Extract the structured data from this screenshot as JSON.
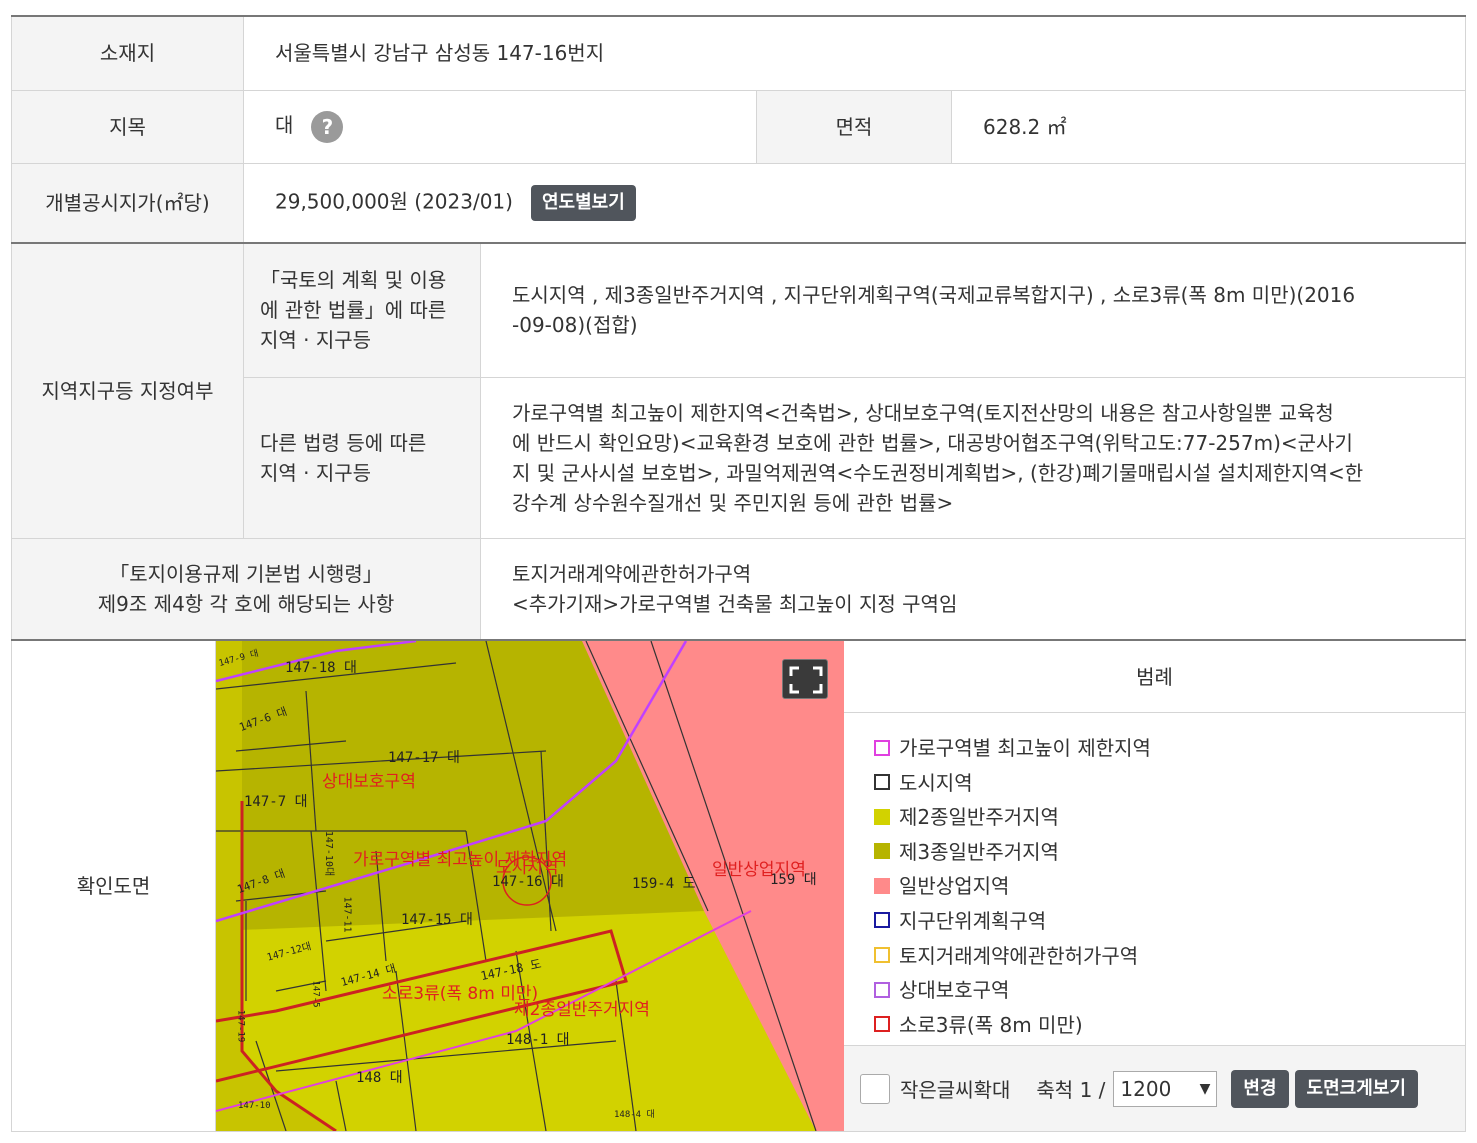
{
  "location": {
    "label": "소재지",
    "value": "서울특별시 강남구 삼성동 147-16번지"
  },
  "land_category": {
    "label": "지목",
    "value": "대",
    "help": "?"
  },
  "area": {
    "label": "면적",
    "value": "628.2 ㎡"
  },
  "price": {
    "label": "개별공시지가(㎡당)",
    "value": "29,500,000원 (2023/01)",
    "button": "연도별보기"
  },
  "zoning": {
    "label": "지역지구등 지정여부",
    "national": {
      "label_lines": [
        "「국토의 계획 및 이용",
        "에 관한 법률」에 따른",
        "지역 · 지구등"
      ],
      "value_lines": [
        "도시지역 , 제3종일반주거지역 , 지구단위계획구역(국제교류복합지구) , 소로3류(폭 8m 미만)(2016",
        "-09-08)(접합)"
      ]
    },
    "other": {
      "label_lines": [
        "다른 법령 등에 따른",
        "지역 · 지구등"
      ],
      "value_lines": [
        "가로구역별 최고높이 제한지역<건축법>, 상대보호구역(토지전산망의 내용은 참고사항일뿐 교육청",
        "에 반드시 확인요망)<교육환경 보호에 관한 법률>, 대공방어협조구역(위탁고도:77-257m)<군사기",
        "지 및 군사시설 보호법>, 과밀억제권역<수도권정비계획법>, (한강)폐기물매립시설 설치제한지역<한",
        "강수계 상수원수질개선 및 주민지원 등에 관한 법률>"
      ]
    }
  },
  "regulation": {
    "label_lines": [
      "「토지이용규제 기본법 시행령」",
      "제9조 제4항 각 호에 해당되는 사항"
    ],
    "value_lines": [
      "토지거래계약에관한허가구역",
      "<추가기재>가로구역별 건축물 최고높이 지정 구역임"
    ]
  },
  "map": {
    "label": "확인도면",
    "parcels": [
      "147-18 대",
      "147-6 대",
      "147-17 대",
      "147-7 대",
      "147-10대",
      "147-8 대",
      "147-16 대",
      "159-4 도",
      "159 대",
      "147-15 대",
      "147-11",
      "147-12대",
      "147-14 대",
      "147-18 도",
      "148-1 대",
      "148 대",
      "147-9 대",
      "147-10",
      "148-4 대",
      "147-5",
      "147-19"
    ],
    "zone_labels": [
      "상대보호구역",
      "가로구역별 최고높이 제한지역",
      "도시지역",
      "일반상업지역",
      "소로3류(폭 8m 미만)",
      "제2종일반주거지역"
    ]
  },
  "legend": {
    "title": "범례",
    "items": [
      {
        "label": "가로구역별 최고높이 제한지역",
        "fill": "#ffffff",
        "border": "#e040e0"
      },
      {
        "label": "도시지역",
        "fill": "#ffffff",
        "border": "#333333"
      },
      {
        "label": "제2종일반주거지역",
        "fill": "#d2d200",
        "border": "#d2d200"
      },
      {
        "label": "제3종일반주거지역",
        "fill": "#b6b400",
        "border": "#b6b400"
      },
      {
        "label": "일반상업지역",
        "fill": "#ff8a8a",
        "border": "#ff8a8a"
      },
      {
        "label": "지구단위계획구역",
        "fill": "#ffffff",
        "border": "#1a1aa0"
      },
      {
        "label": "토지거래계약에관한허가구역",
        "fill": "#ffffff",
        "border": "#f0c030"
      },
      {
        "label": "상대보호구역",
        "fill": "#ffffff",
        "border": "#b060e0"
      },
      {
        "label": "소로3류(폭 8m 미만)",
        "fill": "#ffffff",
        "border": "#dd2020"
      }
    ],
    "enlarge_label": "작은글씨확대",
    "scale_label": "축척 1 /",
    "scale_value": "1200",
    "change_button": "변경",
    "large_view_button": "도면크게보기"
  }
}
